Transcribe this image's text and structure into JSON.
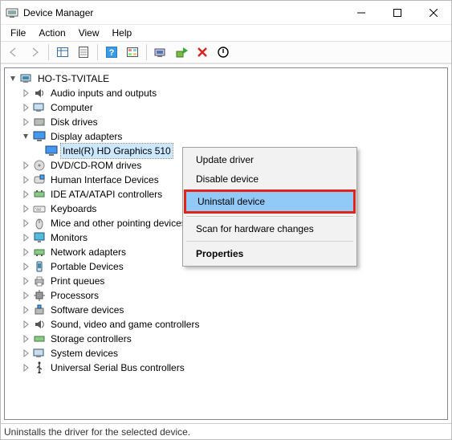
{
  "window": {
    "title": "Device Manager"
  },
  "menus": {
    "file": "File",
    "action": "Action",
    "view": "View",
    "help": "Help"
  },
  "tree": {
    "root": "HO-TS-TVITALE",
    "items": [
      "Audio inputs and outputs",
      "Computer",
      "Disk drives",
      "Display adapters",
      "DVD/CD-ROM drives",
      "Human Interface Devices",
      "IDE ATA/ATAPI controllers",
      "Keyboards",
      "Mice and other pointing devices",
      "Monitors",
      "Network adapters",
      "Portable Devices",
      "Print queues",
      "Processors",
      "Software devices",
      "Sound, video and game controllers",
      "Storage controllers",
      "System devices",
      "Universal Serial Bus controllers"
    ],
    "selected_child": "Intel(R) HD Graphics 510"
  },
  "context_menu": {
    "update": "Update driver",
    "disable": "Disable device",
    "uninstall": "Uninstall device",
    "scan": "Scan for hardware changes",
    "properties": "Properties"
  },
  "status": "Uninstalls the driver for the selected device."
}
